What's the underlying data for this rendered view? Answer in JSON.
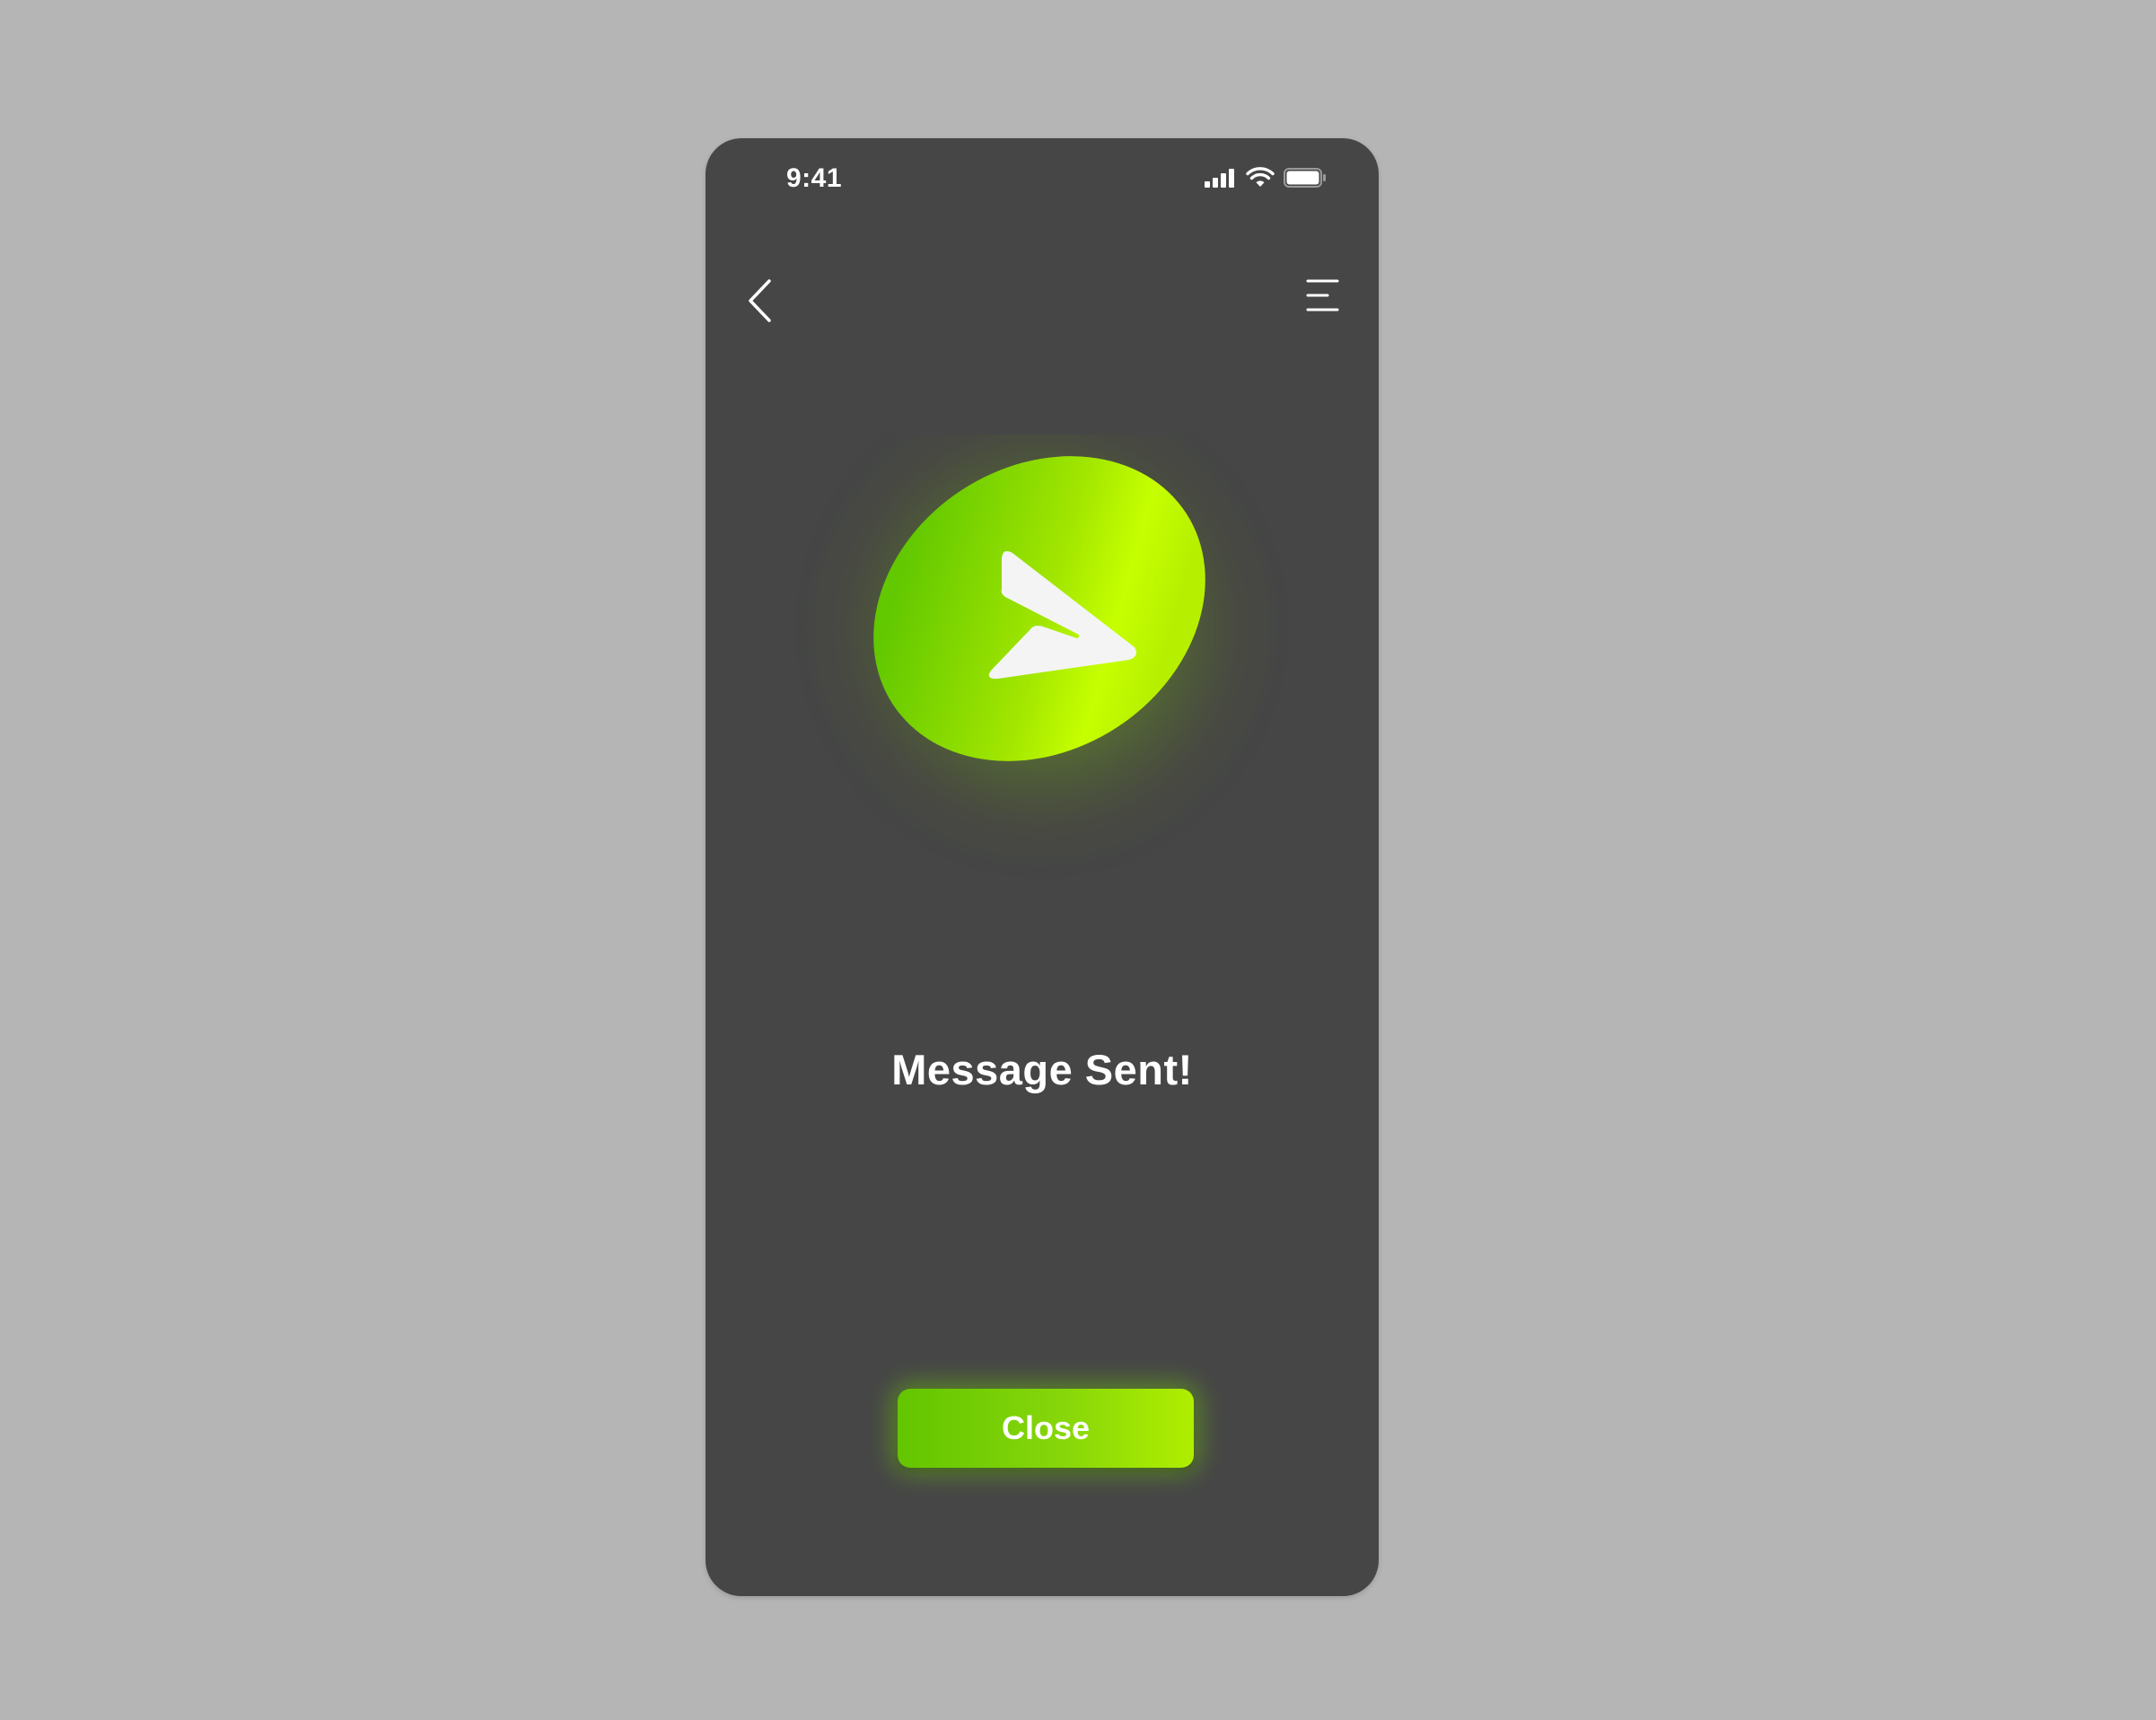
{
  "status_bar": {
    "time": "9:41",
    "icons": [
      "cellular-signal-icon",
      "wifi-icon",
      "battery-icon"
    ]
  },
  "nav": {
    "back_icon": "chevron-left-icon",
    "menu_icon": "menu-icon"
  },
  "hero": {
    "icon": "paper-plane-send-icon"
  },
  "title": "Message Sent!",
  "close_button": {
    "label": "Close"
  },
  "colors": {
    "background": "#b5b5b5",
    "screen": "#464646",
    "accent_start": "#5fc400",
    "accent_end": "#c4ff00",
    "text": "#ffffff"
  }
}
